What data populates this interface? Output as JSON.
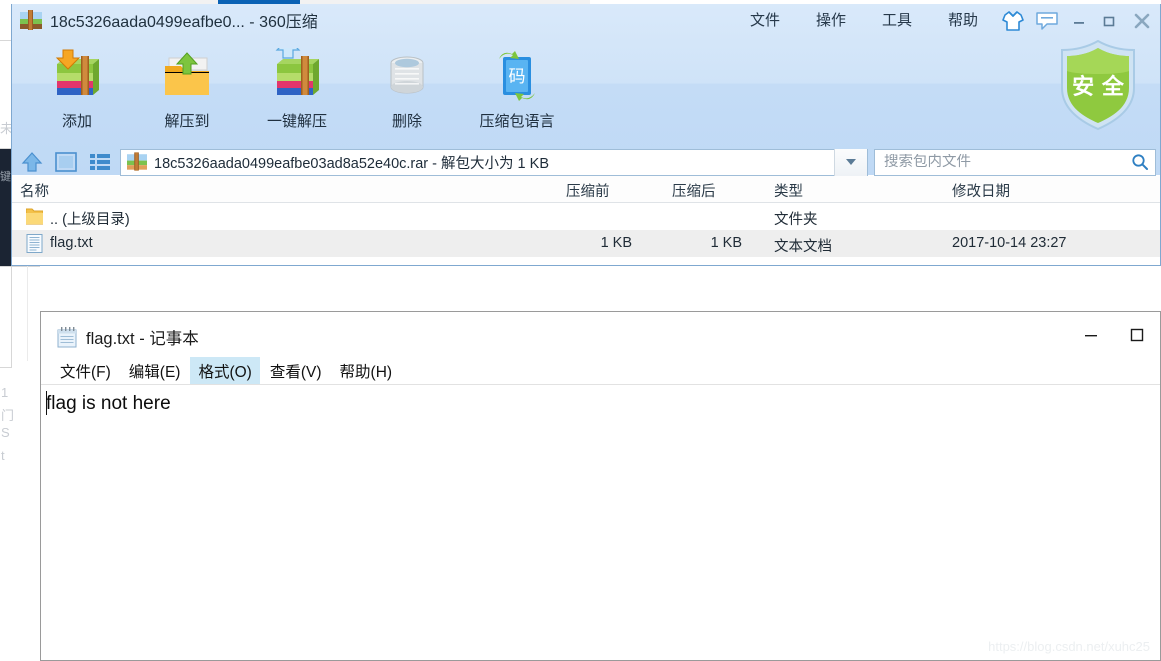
{
  "background": {
    "faint_texts": [
      "未",
      "1",
      "门",
      "S",
      "t",
      "键"
    ],
    "tab_color": "#0a62b5"
  },
  "zip_window": {
    "title": "18c5326aada0499eafbe0... - 360压缩",
    "app_icon": "archive-icon",
    "menus": [
      {
        "label": "文件",
        "name": "menu-file"
      },
      {
        "label": "操作",
        "name": "menu-operate"
      },
      {
        "label": "工具",
        "name": "menu-tools"
      },
      {
        "label": "帮助",
        "name": "menu-help"
      }
    ],
    "system_icons": [
      {
        "name": "skin-shirt-icon"
      },
      {
        "name": "feedback-icon"
      }
    ],
    "window_buttons": [
      {
        "name": "minimize-button"
      },
      {
        "name": "maximize-button"
      },
      {
        "name": "close-button"
      }
    ],
    "toolbar": [
      {
        "label": "添加",
        "name": "toolbar-add",
        "icon": "archive-add-icon"
      },
      {
        "label": "解压到",
        "name": "toolbar-extract-to",
        "icon": "folder-extract-icon"
      },
      {
        "label": "一键解压",
        "name": "toolbar-one-click-extract",
        "icon": "archive-extract-icon"
      },
      {
        "label": "删除",
        "name": "toolbar-delete",
        "icon": "trash-icon"
      },
      {
        "label": "压缩包语言",
        "name": "toolbar-archive-language",
        "icon": "code-language-icon"
      }
    ],
    "shield": {
      "label": "安 全",
      "name": "security-shield-icon",
      "color": "#7cc12a"
    },
    "address": {
      "text": "18c5326aada0499eafbe03ad8a52e40c.rar - 解包大小为 1 KB",
      "icon": "archive-icon",
      "dropdown": "chevron-down-icon"
    },
    "nav_icons": [
      {
        "name": "up-level-icon"
      },
      {
        "name": "preview-pane-icon"
      },
      {
        "name": "list-view-icon"
      }
    ],
    "search": {
      "placeholder": "搜索包内文件",
      "value": "",
      "icon": "search-icon"
    },
    "columns": [
      "名称",
      "压缩前",
      "压缩后",
      "类型",
      "修改日期"
    ],
    "rows": [
      {
        "icon": "folder-up-icon",
        "name": ".. (上级目录)",
        "size_before": "",
        "size_after": "",
        "type": "文件夹",
        "modified": "",
        "selected": false
      },
      {
        "icon": "text-file-icon",
        "name": "flag.txt",
        "size_before": "1 KB",
        "size_after": "1 KB",
        "type": "文本文档",
        "modified": "2017-10-14 23:27",
        "selected": true
      }
    ]
  },
  "notepad": {
    "title": "flag.txt - 记事本",
    "icon": "notepad-icon",
    "menus": [
      {
        "label": "文件(F)",
        "name": "notepad-menu-file",
        "active": false
      },
      {
        "label": "编辑(E)",
        "name": "notepad-menu-edit",
        "active": false
      },
      {
        "label": "格式(O)",
        "name": "notepad-menu-format",
        "active": true
      },
      {
        "label": "查看(V)",
        "name": "notepad-menu-view",
        "active": false
      },
      {
        "label": "帮助(H)",
        "name": "notepad-menu-help",
        "active": false
      }
    ],
    "window_buttons": [
      {
        "name": "minimize-button"
      },
      {
        "name": "maximize-button"
      }
    ],
    "content": "flag is not here"
  },
  "watermark": "https://blog.csdn.net/xuhc25"
}
